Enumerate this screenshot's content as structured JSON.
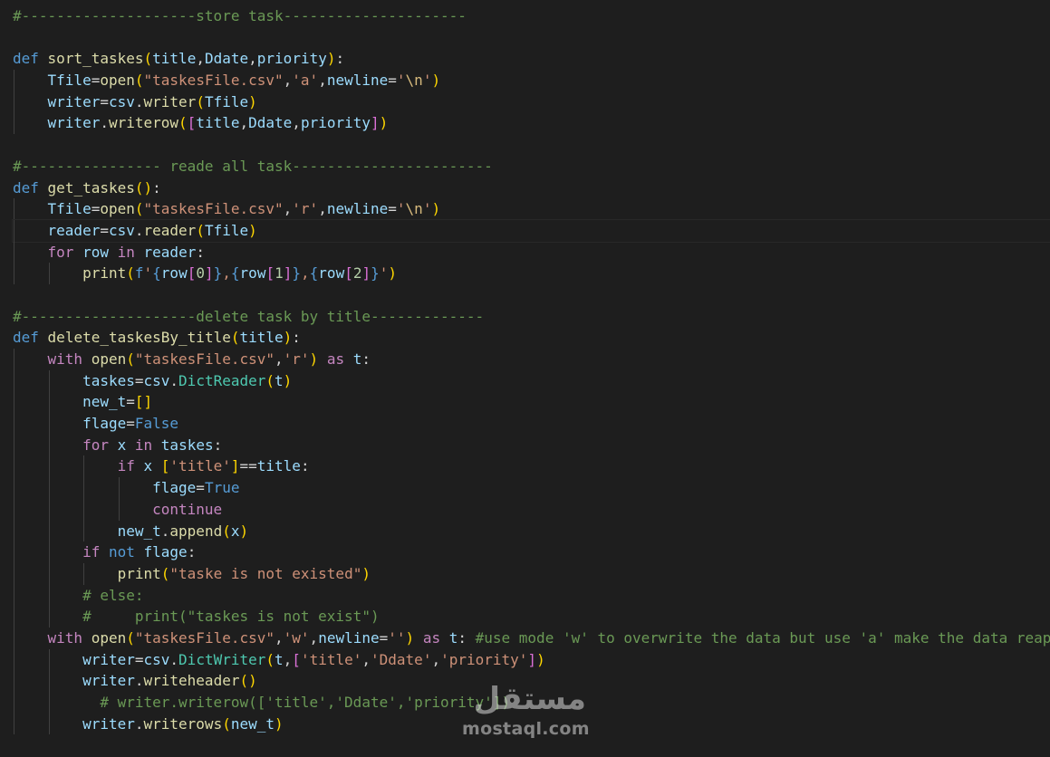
{
  "editor": {
    "colors": {
      "background": "#1e1e1e",
      "keyword": "#569cd6",
      "control": "#c586c0",
      "function": "#dcdcaa",
      "variable": "#9cdcfe",
      "string": "#ce9178",
      "comment": "#6a9955",
      "class": "#4ec9b0",
      "number": "#b5cea8",
      "bracket_level_1": "#ffd700",
      "bracket_level_2": "#da70d6",
      "bracket_level_3": "#179fff"
    },
    "current_line": 11,
    "lines": [
      {
        "indent": 0,
        "tokens": [
          [
            "cmt",
            "#--------------------store task---------------------"
          ]
        ]
      },
      {
        "indent": 0,
        "tokens": []
      },
      {
        "indent": 0,
        "tokens": [
          [
            "kw",
            "def"
          ],
          [
            "op",
            " "
          ],
          [
            "fn",
            "sort_taskes"
          ],
          [
            "p1",
            "("
          ],
          [
            "var",
            "title"
          ],
          [
            "op",
            ","
          ],
          [
            "var",
            "Ddate"
          ],
          [
            "op",
            ","
          ],
          [
            "var",
            "priority"
          ],
          [
            "p1",
            ")"
          ],
          [
            "op",
            ":"
          ]
        ]
      },
      {
        "indent": 1,
        "tokens": [
          [
            "var",
            "Tfile"
          ],
          [
            "op",
            "="
          ],
          [
            "fn",
            "open"
          ],
          [
            "p1",
            "("
          ],
          [
            "str",
            "\"taskesFile.csv\""
          ],
          [
            "op",
            ","
          ],
          [
            "str",
            "'a'"
          ],
          [
            "op",
            ","
          ],
          [
            "var",
            "newline"
          ],
          [
            "op",
            "="
          ],
          [
            "str",
            "'"
          ],
          [
            "esc",
            "\\n"
          ],
          [
            "str",
            "'"
          ],
          [
            "p1",
            ")"
          ]
        ]
      },
      {
        "indent": 1,
        "tokens": [
          [
            "var",
            "writer"
          ],
          [
            "op",
            "="
          ],
          [
            "var",
            "csv"
          ],
          [
            "op",
            "."
          ],
          [
            "fn",
            "writer"
          ],
          [
            "p1",
            "("
          ],
          [
            "var",
            "Tfile"
          ],
          [
            "p1",
            ")"
          ]
        ]
      },
      {
        "indent": 1,
        "tokens": [
          [
            "var",
            "writer"
          ],
          [
            "op",
            "."
          ],
          [
            "fn",
            "writerow"
          ],
          [
            "p1",
            "("
          ],
          [
            "p2",
            "["
          ],
          [
            "var",
            "title"
          ],
          [
            "op",
            ","
          ],
          [
            "var",
            "Ddate"
          ],
          [
            "op",
            ","
          ],
          [
            "var",
            "priority"
          ],
          [
            "p2",
            "]"
          ],
          [
            "p1",
            ")"
          ]
        ]
      },
      {
        "indent": 0,
        "tokens": []
      },
      {
        "indent": 0,
        "tokens": [
          [
            "cmt",
            "#---------------- reade all task-----------------------"
          ]
        ]
      },
      {
        "indent": 0,
        "tokens": [
          [
            "kw",
            "def"
          ],
          [
            "op",
            " "
          ],
          [
            "fn",
            "get_taskes"
          ],
          [
            "p1",
            "()"
          ],
          [
            "op",
            ":"
          ]
        ]
      },
      {
        "indent": 1,
        "tokens": [
          [
            "var",
            "Tfile"
          ],
          [
            "op",
            "="
          ],
          [
            "fn",
            "open"
          ],
          [
            "p1",
            "("
          ],
          [
            "str",
            "\"taskesFile.csv\""
          ],
          [
            "op",
            ","
          ],
          [
            "str",
            "'r'"
          ],
          [
            "op",
            ","
          ],
          [
            "var",
            "newline"
          ],
          [
            "op",
            "="
          ],
          [
            "str",
            "'"
          ],
          [
            "esc",
            "\\n"
          ],
          [
            "str",
            "'"
          ],
          [
            "p1",
            ")"
          ]
        ]
      },
      {
        "indent": 1,
        "tokens": [
          [
            "var",
            "reader"
          ],
          [
            "op",
            "="
          ],
          [
            "var",
            "csv"
          ],
          [
            "op",
            "."
          ],
          [
            "fn",
            "reader"
          ],
          [
            "p1",
            "("
          ],
          [
            "var",
            "Tfile"
          ],
          [
            "p1",
            ")"
          ]
        ]
      },
      {
        "indent": 1,
        "tokens": [
          [
            "ctl",
            "for"
          ],
          [
            "op",
            " "
          ],
          [
            "var",
            "row"
          ],
          [
            "op",
            " "
          ],
          [
            "ctl",
            "in"
          ],
          [
            "op",
            " "
          ],
          [
            "var",
            "reader"
          ],
          [
            "op",
            ":"
          ]
        ]
      },
      {
        "indent": 2,
        "tokens": [
          [
            "fn",
            "print"
          ],
          [
            "p1",
            "("
          ],
          [
            "kw",
            "f"
          ],
          [
            "str",
            "'"
          ],
          [
            "kw",
            "{"
          ],
          [
            "var",
            "row"
          ],
          [
            "p2",
            "["
          ],
          [
            "num",
            "0"
          ],
          [
            "p2",
            "]"
          ],
          [
            "kw",
            "}"
          ],
          [
            "str",
            ","
          ],
          [
            "kw",
            "{"
          ],
          [
            "var",
            "row"
          ],
          [
            "p2",
            "["
          ],
          [
            "num",
            "1"
          ],
          [
            "p2",
            "]"
          ],
          [
            "kw",
            "}"
          ],
          [
            "str",
            ","
          ],
          [
            "kw",
            "{"
          ],
          [
            "var",
            "row"
          ],
          [
            "p2",
            "["
          ],
          [
            "num",
            "2"
          ],
          [
            "p2",
            "]"
          ],
          [
            "kw",
            "}"
          ],
          [
            "str",
            "'"
          ],
          [
            "p1",
            ")"
          ]
        ]
      },
      {
        "indent": 0,
        "tokens": []
      },
      {
        "indent": 0,
        "tokens": [
          [
            "cmt",
            "#--------------------delete task by title-------------"
          ]
        ]
      },
      {
        "indent": 0,
        "tokens": [
          [
            "kw",
            "def"
          ],
          [
            "op",
            " "
          ],
          [
            "fn",
            "delete_taskesBy_title"
          ],
          [
            "p1",
            "("
          ],
          [
            "var",
            "title"
          ],
          [
            "p1",
            ")"
          ],
          [
            "op",
            ":"
          ]
        ]
      },
      {
        "indent": 1,
        "tokens": [
          [
            "ctl",
            "with"
          ],
          [
            "op",
            " "
          ],
          [
            "fn",
            "open"
          ],
          [
            "p1",
            "("
          ],
          [
            "str",
            "\"taskesFile.csv\""
          ],
          [
            "op",
            ","
          ],
          [
            "str",
            "'r'"
          ],
          [
            "p1",
            ")"
          ],
          [
            "op",
            " "
          ],
          [
            "ctl",
            "as"
          ],
          [
            "op",
            " "
          ],
          [
            "var",
            "t"
          ],
          [
            "op",
            ":"
          ]
        ]
      },
      {
        "indent": 2,
        "tokens": [
          [
            "var",
            "taskes"
          ],
          [
            "op",
            "="
          ],
          [
            "var",
            "csv"
          ],
          [
            "op",
            "."
          ],
          [
            "cls",
            "DictReader"
          ],
          [
            "p1",
            "("
          ],
          [
            "var",
            "t"
          ],
          [
            "p1",
            ")"
          ]
        ]
      },
      {
        "indent": 2,
        "tokens": [
          [
            "var",
            "new_t"
          ],
          [
            "op",
            "="
          ],
          [
            "p1",
            "[]"
          ]
        ]
      },
      {
        "indent": 2,
        "tokens": [
          [
            "var",
            "flage"
          ],
          [
            "op",
            "="
          ],
          [
            "bool",
            "False"
          ]
        ]
      },
      {
        "indent": 2,
        "tokens": [
          [
            "ctl",
            "for"
          ],
          [
            "op",
            " "
          ],
          [
            "var",
            "x"
          ],
          [
            "op",
            " "
          ],
          [
            "ctl",
            "in"
          ],
          [
            "op",
            " "
          ],
          [
            "var",
            "taskes"
          ],
          [
            "op",
            ":"
          ]
        ]
      },
      {
        "indent": 3,
        "tokens": [
          [
            "ctl",
            "if"
          ],
          [
            "op",
            " "
          ],
          [
            "var",
            "x"
          ],
          [
            "op",
            " "
          ],
          [
            "p1",
            "["
          ],
          [
            "str",
            "'title'"
          ],
          [
            "p1",
            "]"
          ],
          [
            "op",
            "=="
          ],
          [
            "var",
            "title"
          ],
          [
            "op",
            ":"
          ]
        ]
      },
      {
        "indent": 4,
        "tokens": [
          [
            "var",
            "flage"
          ],
          [
            "op",
            "="
          ],
          [
            "bool",
            "True"
          ]
        ]
      },
      {
        "indent": 4,
        "tokens": [
          [
            "ctl",
            "continue"
          ]
        ]
      },
      {
        "indent": 3,
        "tokens": [
          [
            "var",
            "new_t"
          ],
          [
            "op",
            "."
          ],
          [
            "fn",
            "append"
          ],
          [
            "p1",
            "("
          ],
          [
            "var",
            "x"
          ],
          [
            "p1",
            ")"
          ]
        ]
      },
      {
        "indent": 2,
        "tokens": [
          [
            "ctl",
            "if"
          ],
          [
            "op",
            " "
          ],
          [
            "kw",
            "not"
          ],
          [
            "op",
            " "
          ],
          [
            "var",
            "flage"
          ],
          [
            "op",
            ":"
          ]
        ]
      },
      {
        "indent": 3,
        "tokens": [
          [
            "fn",
            "print"
          ],
          [
            "p1",
            "("
          ],
          [
            "str",
            "\"taske is not existed\""
          ],
          [
            "p1",
            ")"
          ]
        ]
      },
      {
        "indent": 2,
        "tokens": [
          [
            "cmt",
            "# else:"
          ]
        ]
      },
      {
        "indent": 2,
        "tokens": [
          [
            "cmt",
            "#     print(\"taskes is not exist\")"
          ]
        ]
      },
      {
        "indent": 1,
        "tokens": [
          [
            "ctl",
            "with"
          ],
          [
            "op",
            " "
          ],
          [
            "fn",
            "open"
          ],
          [
            "p1",
            "("
          ],
          [
            "str",
            "\"taskesFile.csv\""
          ],
          [
            "op",
            ","
          ],
          [
            "str",
            "'w'"
          ],
          [
            "op",
            ","
          ],
          [
            "var",
            "newline"
          ],
          [
            "op",
            "="
          ],
          [
            "str",
            "''"
          ],
          [
            "p1",
            ")"
          ],
          [
            "op",
            " "
          ],
          [
            "ctl",
            "as"
          ],
          [
            "op",
            " "
          ],
          [
            "var",
            "t"
          ],
          [
            "op",
            ": "
          ],
          [
            "cmt",
            "#use mode 'w' to overwrite the data but use 'a' make the data reap"
          ]
        ]
      },
      {
        "indent": 2,
        "tokens": [
          [
            "var",
            "writer"
          ],
          [
            "op",
            "="
          ],
          [
            "var",
            "csv"
          ],
          [
            "op",
            "."
          ],
          [
            "cls",
            "DictWriter"
          ],
          [
            "p1",
            "("
          ],
          [
            "var",
            "t"
          ],
          [
            "op",
            ","
          ],
          [
            "p2",
            "["
          ],
          [
            "str",
            "'title'"
          ],
          [
            "op",
            ","
          ],
          [
            "str",
            "'Ddate'"
          ],
          [
            "op",
            ","
          ],
          [
            "str",
            "'priority'"
          ],
          [
            "p2",
            "]"
          ],
          [
            "p1",
            ")"
          ]
        ]
      },
      {
        "indent": 2,
        "tokens": [
          [
            "var",
            "writer"
          ],
          [
            "op",
            "."
          ],
          [
            "fn",
            "writeheader"
          ],
          [
            "p1",
            "()"
          ]
        ]
      },
      {
        "indent": 2,
        "pre": "  ",
        "tokens": [
          [
            "cmt",
            "# writer.writerow(['title','Ddate','priority'])"
          ]
        ]
      },
      {
        "indent": 2,
        "tokens": [
          [
            "var",
            "writer"
          ],
          [
            "op",
            "."
          ],
          [
            "fn",
            "writerows"
          ],
          [
            "p1",
            "("
          ],
          [
            "var",
            "new_t"
          ],
          [
            "p1",
            ")"
          ]
        ]
      }
    ]
  },
  "watermark": {
    "arabic": "مستقل",
    "latin": "mostaql.com"
  }
}
